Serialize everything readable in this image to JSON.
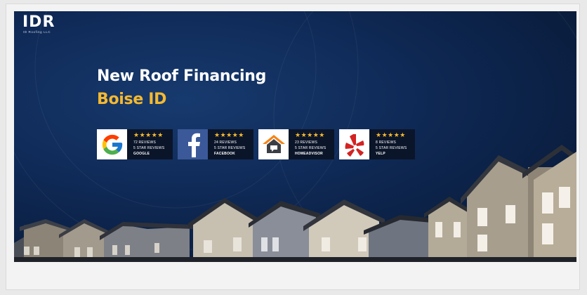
{
  "logo": {
    "text": "IDR",
    "sub": "ID Roofing LLC"
  },
  "hero": {
    "title": "New Roof Financing",
    "subtitle": "Boise ID",
    "colors": {
      "background": "#0f2a57",
      "accent": "#f5b930"
    }
  },
  "badges": [
    {
      "icon": "google-icon",
      "stars": "★★★★★",
      "reviews": "72 REVIEWS",
      "rating": "5 STAR REVIEWS",
      "source": "GOOGLE"
    },
    {
      "icon": "facebook-icon",
      "stars": "★★★★★",
      "reviews": "24 REVIEWS",
      "rating": "5 STAR REVIEWS",
      "source": "FACEBOOK"
    },
    {
      "icon": "homeadvisor-icon",
      "stars": "★★★★★",
      "reviews": "23 REVIEWS",
      "rating": "5 STAR REVIEWS",
      "source": "HOMEADVISOR"
    },
    {
      "icon": "yelp-icon",
      "stars": "★★★★★",
      "reviews": "8 REVIEWS",
      "rating": "5 STAR REVIEWS",
      "source": "YELP"
    }
  ]
}
